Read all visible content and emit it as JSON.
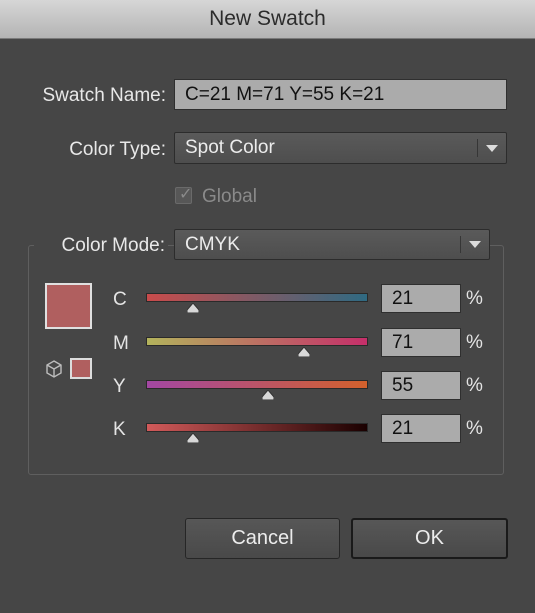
{
  "window": {
    "title": "New Swatch"
  },
  "swatch_name": {
    "label": "Swatch Name:",
    "value": "C=21 M=71 Y=55 K=21"
  },
  "color_type": {
    "label": "Color Type:",
    "value": "Spot Color"
  },
  "global": {
    "label": "Global",
    "checked": true,
    "enabled": false
  },
  "color_mode": {
    "label": "Color Mode:",
    "value": "CMYK"
  },
  "swatch_color": "#b05f5f",
  "channels": [
    {
      "name": "C",
      "value": "21",
      "unit": "%",
      "fraction": 0.21,
      "gradient": [
        "#c94b4b",
        "#2f6a82"
      ]
    },
    {
      "name": "M",
      "value": "71",
      "unit": "%",
      "fraction": 0.71,
      "gradient": [
        "#b3b35c",
        "#c52f6a"
      ]
    },
    {
      "name": "Y",
      "value": "55",
      "unit": "%",
      "fraction": 0.55,
      "gradient": [
        "#a347a3",
        "#d3612c"
      ]
    },
    {
      "name": "K",
      "value": "21",
      "unit": "%",
      "fraction": 0.21,
      "gradient": [
        "#d25a5a",
        "#1a0000"
      ]
    }
  ],
  "buttons": {
    "cancel": "Cancel",
    "ok": "OK"
  }
}
